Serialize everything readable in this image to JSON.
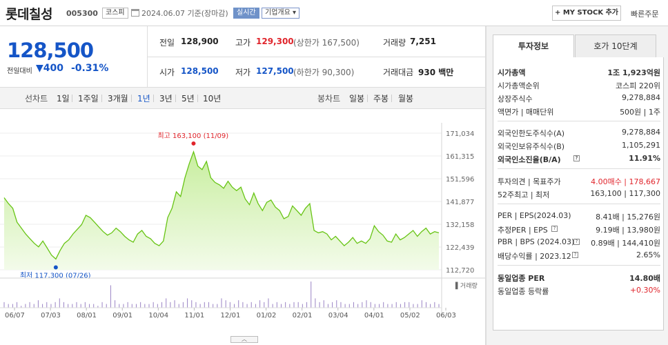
{
  "header": {
    "name": "롯데칠성",
    "code": "005300",
    "market": "코스피",
    "date": "2024.06.07  기준(장마감)",
    "realtime": "실시간",
    "overview": "기업개요 ▾",
    "mystock": "+ MY STOCK 추가",
    "quick_order": "빠른주문"
  },
  "quote": {
    "price": "128,500",
    "change_label": "전일대비",
    "change": "▼400",
    "change_pct": "-0.31%",
    "prev_label": "전일",
    "prev": "128,900",
    "high_label": "고가",
    "high": "129,300",
    "upper_limit": "(상한가 167,500)",
    "volume_label": "거래량",
    "volume": "7,251",
    "open_label": "시가",
    "open": "128,500",
    "low_label": "저가",
    "low": "127,500",
    "lower_limit": "(하한가 90,300)",
    "amount_label": "거래대금",
    "amount": "930 백만"
  },
  "periods": {
    "line_label": "선차트",
    "line": [
      "1일",
      "1주일",
      "3개월",
      "1년",
      "3년",
      "5년",
      "10년"
    ],
    "active": "1년",
    "candle_label": "봉차트",
    "candle": [
      "일봉",
      "주봉",
      "월봉"
    ]
  },
  "colors": {
    "up": "#e0242b",
    "down": "#1555c7",
    "line": "#67c414",
    "fill": "#dff5c6"
  },
  "chart_data": {
    "type": "area",
    "y_ticks": [
      "171,034",
      "161,315",
      "151,596",
      "141,877",
      "132,158",
      "122,439",
      "112,720"
    ],
    "ylim": [
      112720,
      171034
    ],
    "x_labels": [
      "06/07",
      "07/03",
      "08/01",
      "09/01",
      "10/04",
      "11/01",
      "12/01",
      "01/02",
      "02/01",
      "03/04",
      "04/01",
      "05/02",
      "06/03"
    ],
    "values": [
      143500,
      141000,
      139000,
      133000,
      130500,
      128000,
      126000,
      124000,
      122500,
      125000,
      122000,
      119000,
      117300,
      121000,
      124000,
      125500,
      128000,
      130000,
      132000,
      136000,
      135000,
      133000,
      131000,
      129000,
      127500,
      128500,
      130500,
      129000,
      127000,
      125500,
      124500,
      128000,
      129500,
      127000,
      126000,
      124000,
      123000,
      125000,
      135000,
      139000,
      146000,
      144000,
      152000,
      158000,
      163100,
      157000,
      155500,
      159000,
      152000,
      150000,
      149000,
      147500,
      150500,
      148000,
      146500,
      148000,
      143000,
      140500,
      145500,
      141000,
      138000,
      141500,
      142500,
      139500,
      138000,
      134500,
      135500,
      140000,
      138000,
      136000,
      139000,
      141000,
      129500,
      128500,
      129000,
      128000,
      125500,
      127000,
      125000,
      123000,
      124500,
      126500,
      124000,
      125000,
      124000,
      126000,
      131500,
      129000,
      127500,
      125000,
      124500,
      128000,
      125500,
      126500,
      128000,
      129500,
      127000,
      129000,
      130500,
      128000,
      129000,
      128500
    ],
    "high_label": "최고 163,100 (11/09)",
    "low_label": "최저 117,300 (07/26)",
    "volume_label": "거래량",
    "volume": [
      3,
      2,
      2,
      3,
      1,
      2,
      3,
      2,
      4,
      2,
      3,
      2,
      3,
      5,
      3,
      2,
      2,
      3,
      2,
      3,
      2,
      2,
      1,
      3,
      2,
      12,
      4,
      2,
      2,
      3,
      2,
      2,
      3,
      2,
      2,
      3,
      2,
      3,
      5,
      3,
      4,
      2,
      3,
      5,
      4,
      3,
      2,
      3,
      3,
      2,
      2,
      5,
      4,
      3,
      2,
      4,
      3,
      2,
      3,
      2,
      4,
      3,
      5,
      2,
      3,
      2,
      3,
      2,
      3,
      3,
      2,
      3,
      14,
      5,
      3,
      4,
      2,
      3,
      4,
      3,
      2,
      2,
      3,
      2,
      3,
      4,
      3,
      2,
      2,
      3,
      2,
      2,
      3,
      2,
      3,
      3,
      2,
      2,
      4,
      3,
      2,
      3,
      2
    ]
  },
  "side": {
    "tab1": "투자정보",
    "tab2": "호가 10단계",
    "rows": [
      {
        "l": "시가총액",
        "r": "1조 1,923억원",
        "bold": true
      },
      {
        "l": "시가총액순위",
        "r": "코스피 220위"
      },
      {
        "l": "상장주식수",
        "r": "9,278,884"
      },
      {
        "l": "액면가 | 매매단위",
        "r": "500원 | 1주"
      },
      {
        "l": "외국인한도주식수(A)",
        "r": "9,278,884"
      },
      {
        "l": "외국인보유주식수(B)",
        "r": "1,105,291"
      },
      {
        "l": "외국인소진율(B/A)",
        "r": "11.91%",
        "bold": true
      },
      {
        "l": "투자의견 | 목표주가",
        "r": "4.00매수 | 178,667"
      },
      {
        "l": "52주최고 | 최저",
        "r": "163,100 | 117,300"
      },
      {
        "l": "PER | EPS(2024.03)",
        "r": "8.41배 | 15,276원"
      },
      {
        "l": "추정PER | EPS",
        "r": "9.19배 | 13,980원"
      },
      {
        "l": "PBR | BPS (2024.03)",
        "r": "0.89배 | 144,410원"
      },
      {
        "l": "배당수익률 | 2023.12",
        "r": "2.65%"
      },
      {
        "l": "동일업종 PER",
        "r": "14.80배",
        "bold": true
      },
      {
        "l": "동일업종 등락률",
        "r": "+0.30%"
      }
    ]
  }
}
